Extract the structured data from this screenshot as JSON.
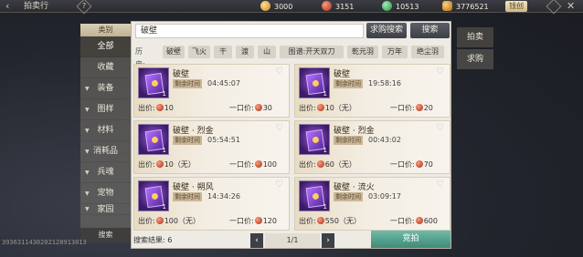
{
  "header": {
    "back_symbol": "‹",
    "title": "拍卖行",
    "help_symbol": "?",
    "currencies": [
      {
        "icon": "gold-coin-icon",
        "value": "3000"
      },
      {
        "icon": "red-coin-icon",
        "value": "3151"
      },
      {
        "icon": "jade-icon",
        "value": "10513"
      },
      {
        "icon": "ingot-icon",
        "value": "3776521"
      }
    ],
    "recharge_label": "钱创",
    "close_symbol": "✕"
  },
  "categories": {
    "header": "类别",
    "items": [
      "全部",
      "收藏",
      "装备",
      "图样",
      "材料",
      "消耗品",
      "兵魂",
      "宠物",
      "家园"
    ],
    "expandable": [
      false,
      false,
      true,
      true,
      true,
      true,
      true,
      true,
      true
    ],
    "active_index": 0,
    "search_tab": "搜索"
  },
  "search": {
    "value": "破壁",
    "want_buy_label": "求购搜索",
    "search_label": "搜索"
  },
  "history": {
    "label": "历史:",
    "chips": [
      "破壁",
      "飞火",
      "干",
      "渡",
      "山",
      "图谱:开天双刀",
      "乾元羽",
      "万年",
      "绝尘羽"
    ]
  },
  "listings": [
    {
      "name": "破壁",
      "icon": "scroll-icon",
      "qty": "1",
      "time_label": "剩余时间",
      "time": "04:45:07",
      "bid_label": "出价:",
      "bid": "10",
      "buy_label": "一口价:",
      "buy": "30"
    },
    {
      "name": "破壁",
      "icon": "scroll-icon",
      "qty": "1",
      "time_label": "剩余时间",
      "time": "19:58:16",
      "bid_label": "出价:",
      "bid": "10（无）",
      "buy_label": "一口价:",
      "buy": "20"
    },
    {
      "name": "破壁 · 烈金",
      "icon": "purple-book-icon",
      "qty": "1",
      "time_label": "剩余时间",
      "time": "05:54:51",
      "bid_label": "出价:",
      "bid": "10（无）",
      "buy_label": "一口价:",
      "buy": "100"
    },
    {
      "name": "破壁 · 烈金",
      "icon": "purple-book-icon",
      "qty": "1",
      "time_label": "剩余时间",
      "time": "00:43:02",
      "bid_label": "出价:",
      "bid": "60（无）",
      "buy_label": "一口价:",
      "buy": "70"
    },
    {
      "name": "破壁 · 朔风",
      "icon": "purple-book-icon",
      "qty": "1",
      "time_label": "剩余时间",
      "time": "14:34:26",
      "bid_label": "出价:",
      "bid": "100（无）",
      "buy_label": "一口价:",
      "buy": "120"
    },
    {
      "name": "破壁 · 流火",
      "icon": "purple-book-icon",
      "qty": "1",
      "time_label": "剩余时间",
      "time": "03:09:17",
      "bid_label": "出价:",
      "bid": "550（无）",
      "buy_label": "一口价:",
      "buy": "600"
    }
  ],
  "footer": {
    "result_label": "搜索结果:",
    "result_count": "6",
    "page": "1/1",
    "prev": "‹",
    "next": "›",
    "bid_button": "竞拍"
  },
  "right_tabs": [
    "拍卖",
    "求购"
  ],
  "right_active_index": 0,
  "bottom_id": "3936311430202128913013"
}
